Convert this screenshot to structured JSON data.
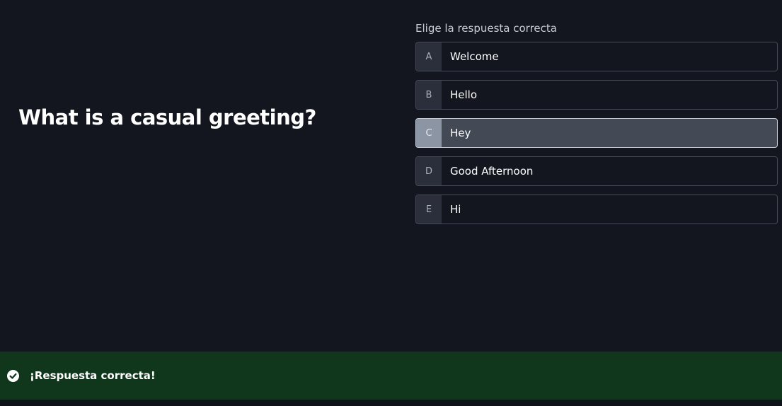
{
  "question": {
    "text": "What is a casual greeting?"
  },
  "answers": {
    "instruction": "Elige la respuesta correcta",
    "options": [
      {
        "letter": "A",
        "label": "Welcome"
      },
      {
        "letter": "B",
        "label": "Hello"
      },
      {
        "letter": "C",
        "label": "Hey"
      },
      {
        "letter": "D",
        "label": "Good Afternoon"
      },
      {
        "letter": "E",
        "label": "Hi"
      }
    ],
    "selected_letter": "C"
  },
  "feedback": {
    "icon": "check-circle-icon",
    "text": "¡Respuesta correcta!",
    "color": "#10361c"
  },
  "colors": {
    "background": "#13161f",
    "selected_option": "#434955"
  }
}
